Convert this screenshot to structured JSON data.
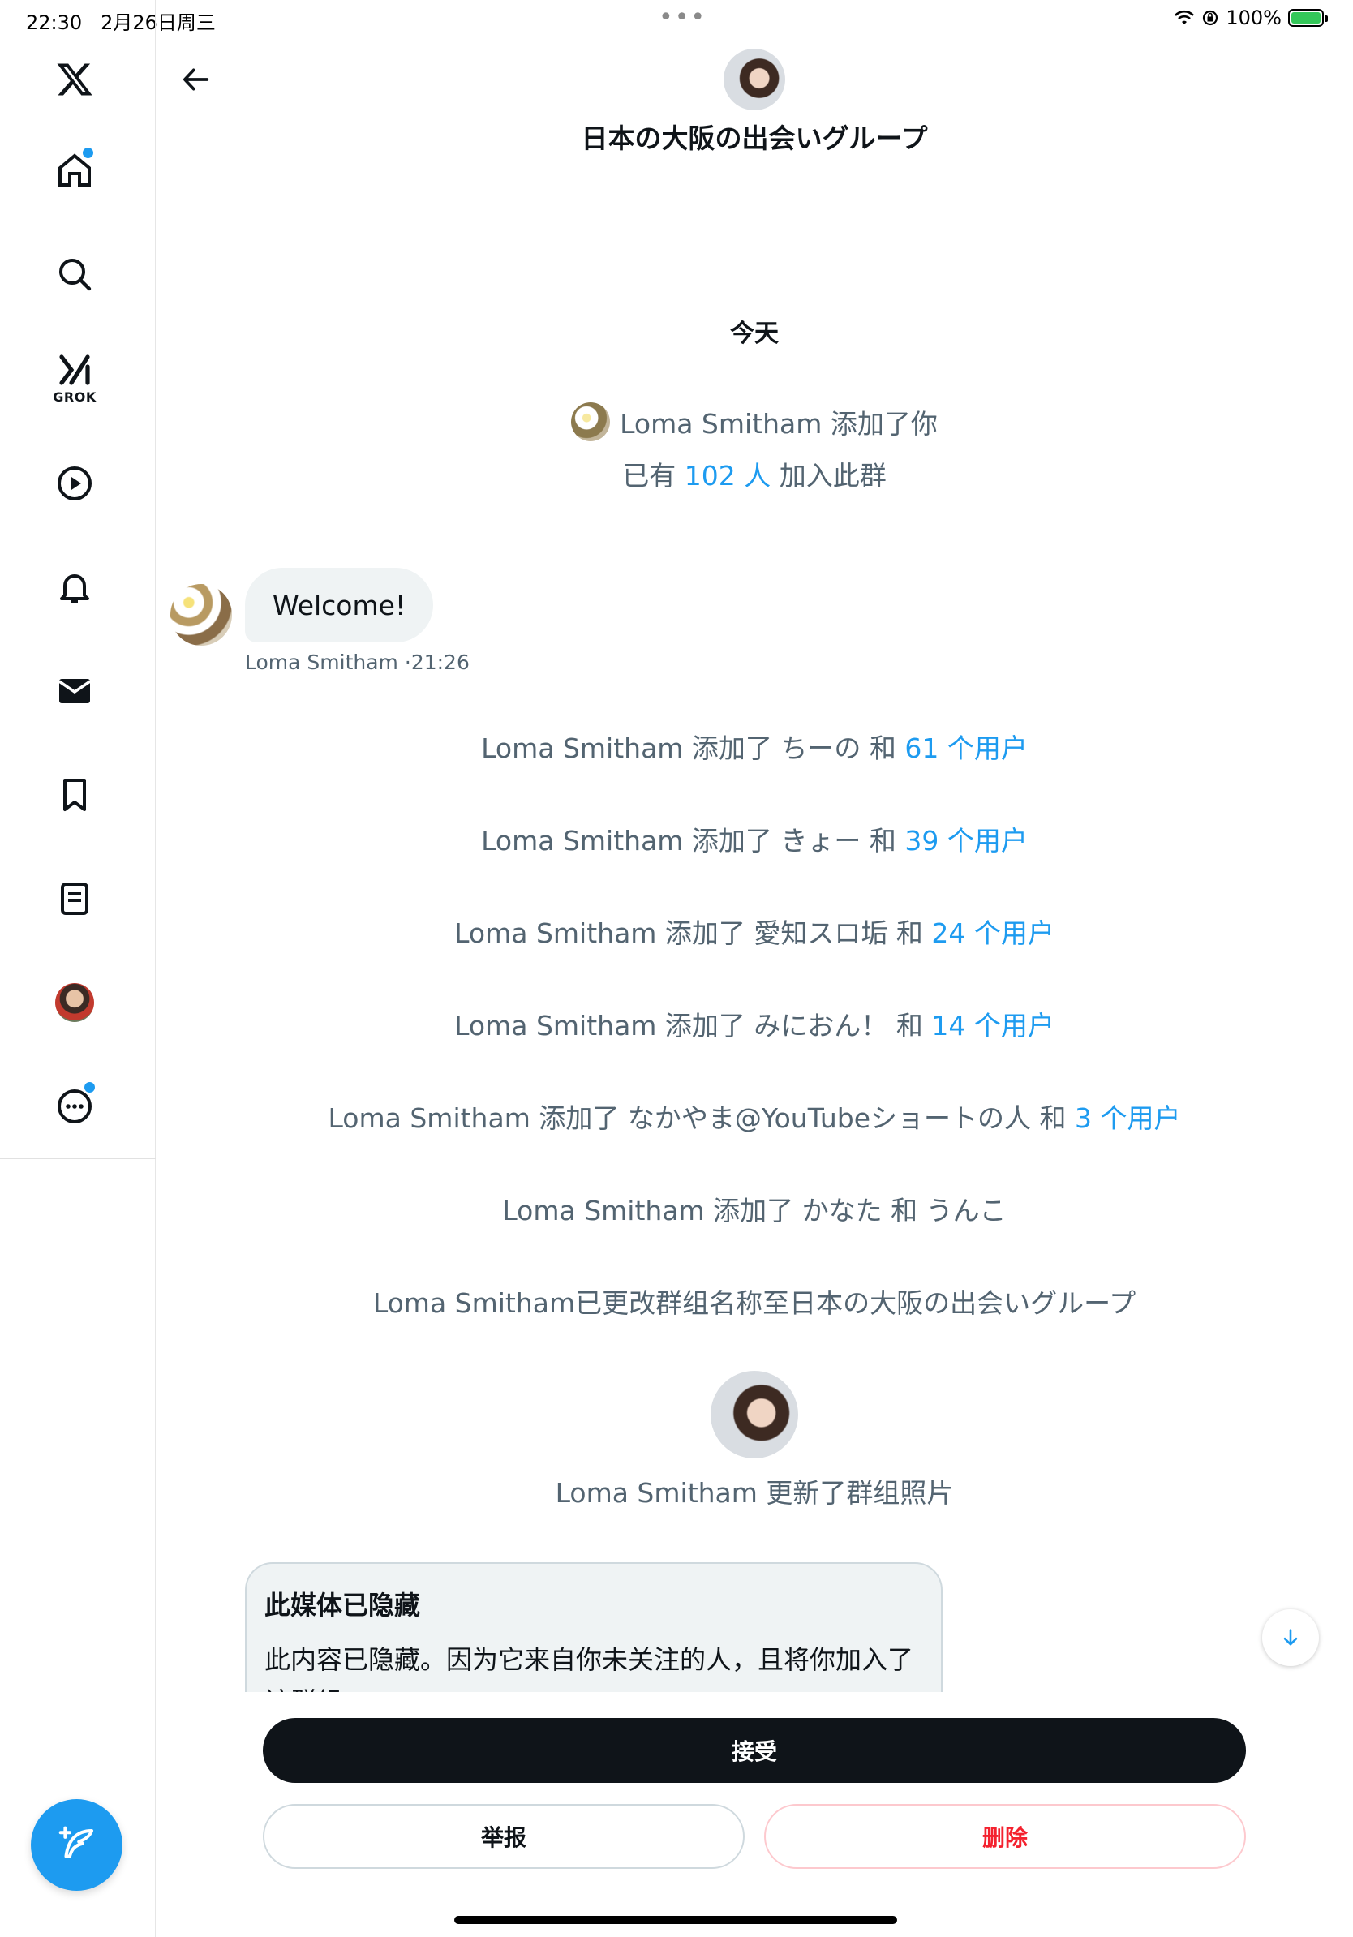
{
  "status_bar": {
    "time": "22:30",
    "date": "2月26日周三",
    "battery": "100%",
    "icons": [
      "wifi-icon",
      "orientation-lock-icon",
      "battery-charging-icon"
    ]
  },
  "sidebar": {
    "items": [
      {
        "name": "x-logo-icon"
      },
      {
        "name": "home-icon",
        "has_dot": true
      },
      {
        "name": "search-icon"
      },
      {
        "name": "grok-icon",
        "label": "GROK"
      },
      {
        "name": "video-icon"
      },
      {
        "name": "notifications-icon"
      },
      {
        "name": "messages-icon"
      },
      {
        "name": "bookmarks-icon"
      },
      {
        "name": "lists-icon"
      },
      {
        "name": "profile-avatar"
      },
      {
        "name": "more-icon",
        "has_dot": true
      }
    ],
    "compose_icon": "compose-icon"
  },
  "header": {
    "title": "日本の大阪の出会いグループ",
    "back_icon": "back-arrow-icon"
  },
  "conversation": {
    "date_label": "今天",
    "added_you": "Loma Smitham 添加了你",
    "members_prefix": "已有",
    "members_count": "102 人",
    "members_suffix": "加入此群",
    "message": {
      "text": "Welcome!",
      "sender": "Loma Smitham",
      "time": "21:26",
      "separator": "·"
    },
    "events": [
      {
        "text": "Loma Smitham 添加了 ちーの 和",
        "link": "61 个用户"
      },
      {
        "text": "Loma Smitham 添加了 きょー 和",
        "link": "39 个用户"
      },
      {
        "text": "Loma Smitham 添加了 愛知スロ垢 和",
        "link": "24 个用户"
      },
      {
        "text": "Loma Smitham 添加了 みにおん！ 和",
        "link": "14 个用户"
      },
      {
        "text": "Loma Smitham 添加了 なかやま@YouTubeショートの人 和",
        "link": "3 个用户"
      },
      {
        "text": "Loma Smitham 添加了 かなた 和 うんこ",
        "link": ""
      },
      {
        "text": "Loma Smitham已更改群组名称至日本の大阪の出会いグループ",
        "link": ""
      }
    ],
    "photo_update": "Loma Smitham 更新了群组照片",
    "hidden_media": {
      "title": "此媒体已隐藏",
      "body": "此内容已隐藏。因为它来自你未关注的人，且将你加入了该群组"
    }
  },
  "actions": {
    "accept": "接受",
    "report": "举报",
    "delete": "删除"
  },
  "colors": {
    "accent": "#1d9bf0",
    "text_primary": "#0f1419",
    "text_secondary": "#536471",
    "danger": "#f4212e",
    "bubble": "#eff3f4"
  }
}
